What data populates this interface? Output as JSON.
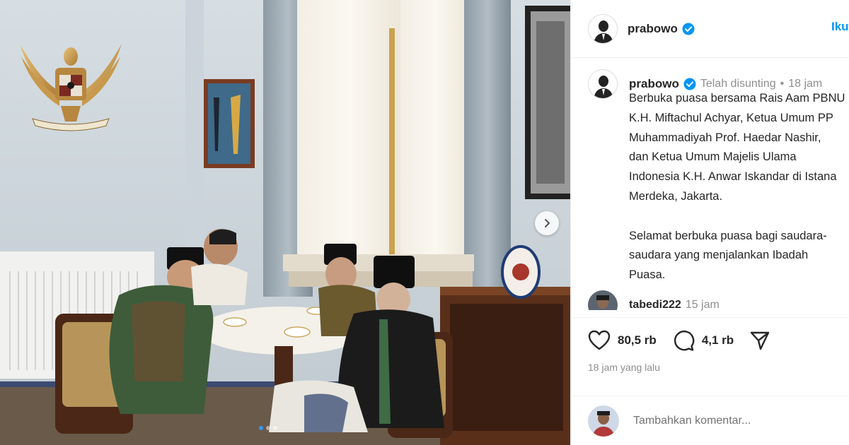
{
  "post": {
    "username": "prabowo",
    "follow_label": "Ikuti",
    "edited_label": "Telah disunting",
    "time_short": "18 jam",
    "caption_lines": [
      "Berbuka puasa bersama Rais Aam PBNU",
      "K.H. Miftachul Achyar, Ketua Umum PP",
      "Muhammadiyah Prof. Haedar Nashir,",
      "dan Ketua Umum Majelis Ulama",
      "Indonesia K.H. Anwar Iskandar di Istana",
      "Merdeka, Jakarta.",
      "",
      "Selamat berbuka puasa bagi saudara-",
      "saudara yang menjalankan Ibadah",
      "Puasa."
    ],
    "separator": "•"
  },
  "comment": {
    "username": "tabedi222",
    "time": "15 jam"
  },
  "actions": {
    "likes": "80,5 rb",
    "comments": "4,1 rb",
    "posted_ago": "18 jam yang lalu"
  },
  "composer": {
    "placeholder": "Tambahkan komentar..."
  },
  "carousel": {
    "slides": 3,
    "active_slide": 1
  },
  "colors": {
    "verified": "#0095f6",
    "link": "#0095f6",
    "muted": "#8e8e8e"
  },
  "icons": {
    "like": "heart-icon",
    "comment": "comment-icon",
    "share": "paper-plane-icon",
    "next": "chevron-right-icon",
    "verified": "verified-badge-icon"
  }
}
